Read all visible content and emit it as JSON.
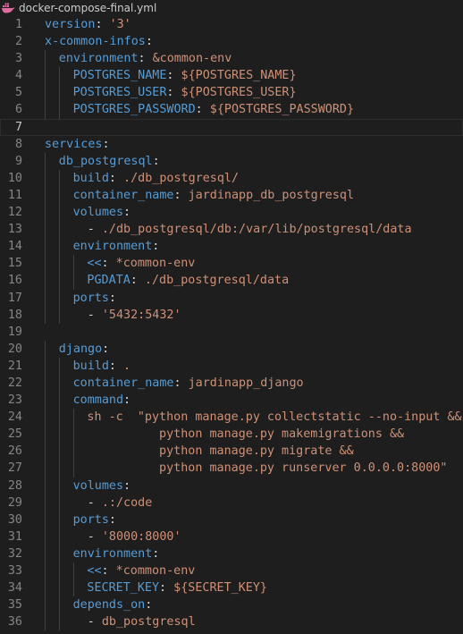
{
  "tab": {
    "filename": "docker-compose-final.yml",
    "icon": "docker-whale-icon"
  },
  "colors": {
    "background": "#1e1e1e",
    "key": "#569cd6",
    "string": "#ce9178",
    "punct": "#d4d4d4",
    "line_number": "#858585"
  },
  "current_line": 7,
  "lines": [
    {
      "n": "1",
      "indent": 0,
      "tokens": [
        [
          "k",
          "version"
        ],
        [
          "p",
          ": "
        ],
        [
          "s",
          "'3'"
        ]
      ]
    },
    {
      "n": "2",
      "indent": 0,
      "tokens": [
        [
          "k",
          "x-common-infos"
        ],
        [
          "p",
          ":"
        ]
      ]
    },
    {
      "n": "3",
      "indent": 1,
      "tokens": [
        [
          "k",
          "environment"
        ],
        [
          "p",
          ": "
        ],
        [
          "a",
          "&common-env"
        ]
      ]
    },
    {
      "n": "4",
      "indent": 2,
      "tokens": [
        [
          "k",
          "POSTGRES_NAME"
        ],
        [
          "p",
          ": "
        ],
        [
          "s",
          "${POSTGRES_NAME}"
        ]
      ]
    },
    {
      "n": "5",
      "indent": 2,
      "tokens": [
        [
          "k",
          "POSTGRES_USER"
        ],
        [
          "p",
          ": "
        ],
        [
          "s",
          "${POSTGRES_USER}"
        ]
      ]
    },
    {
      "n": "6",
      "indent": 2,
      "tokens": [
        [
          "k",
          "POSTGRES_PASSWORD"
        ],
        [
          "p",
          ": "
        ],
        [
          "s",
          "${POSTGRES_PASSWORD}"
        ]
      ]
    },
    {
      "n": "7",
      "indent": 0,
      "tokens": []
    },
    {
      "n": "8",
      "indent": 0,
      "tokens": [
        [
          "k",
          "services"
        ],
        [
          "p",
          ":"
        ]
      ]
    },
    {
      "n": "9",
      "indent": 1,
      "tokens": [
        [
          "k",
          "db_postgresql"
        ],
        [
          "p",
          ":"
        ]
      ]
    },
    {
      "n": "10",
      "indent": 2,
      "tokens": [
        [
          "k",
          "build"
        ],
        [
          "p",
          ": "
        ],
        [
          "s",
          "./db_postgresql/"
        ]
      ]
    },
    {
      "n": "11",
      "indent": 2,
      "tokens": [
        [
          "k",
          "container_name"
        ],
        [
          "p",
          ": "
        ],
        [
          "s",
          "jardinapp_db_postgresql"
        ]
      ]
    },
    {
      "n": "12",
      "indent": 2,
      "tokens": [
        [
          "k",
          "volumes"
        ],
        [
          "p",
          ":"
        ]
      ]
    },
    {
      "n": "13",
      "indent": 2,
      "tokens": [
        [
          "p",
          "  - "
        ],
        [
          "s",
          "./db_postgresql/db:/var/lib/postgresql/data"
        ]
      ]
    },
    {
      "n": "14",
      "indent": 2,
      "tokens": [
        [
          "k",
          "environment"
        ],
        [
          "p",
          ":"
        ]
      ]
    },
    {
      "n": "15",
      "indent": 3,
      "tokens": [
        [
          "k",
          "<<"
        ],
        [
          "p",
          ": "
        ],
        [
          "a",
          "*common-env"
        ]
      ]
    },
    {
      "n": "16",
      "indent": 3,
      "tokens": [
        [
          "k",
          "PGDATA"
        ],
        [
          "p",
          ": "
        ],
        [
          "s",
          "./db_postgresql/data"
        ]
      ]
    },
    {
      "n": "17",
      "indent": 2,
      "tokens": [
        [
          "k",
          "ports"
        ],
        [
          "p",
          ":"
        ]
      ]
    },
    {
      "n": "18",
      "indent": 2,
      "tokens": [
        [
          "p",
          "  - "
        ],
        [
          "s",
          "'5432:5432'"
        ]
      ]
    },
    {
      "n": "19",
      "indent": 0,
      "tokens": []
    },
    {
      "n": "20",
      "indent": 1,
      "tokens": [
        [
          "k",
          "django"
        ],
        [
          "p",
          ":"
        ]
      ]
    },
    {
      "n": "21",
      "indent": 2,
      "tokens": [
        [
          "k",
          "build"
        ],
        [
          "p",
          ": "
        ],
        [
          "s",
          "."
        ]
      ]
    },
    {
      "n": "22",
      "indent": 2,
      "tokens": [
        [
          "k",
          "container_name"
        ],
        [
          "p",
          ": "
        ],
        [
          "s",
          "jardinapp_django"
        ]
      ]
    },
    {
      "n": "23",
      "indent": 2,
      "tokens": [
        [
          "k",
          "command"
        ],
        [
          "p",
          ":"
        ]
      ]
    },
    {
      "n": "24",
      "indent": 3,
      "tokens": [
        [
          "s",
          "sh -c  \"python manage.py collectstatic --no-input &&"
        ]
      ]
    },
    {
      "n": "25",
      "indent": 3,
      "tokens": [
        [
          "s",
          "          python manage.py makemigrations &&"
        ]
      ]
    },
    {
      "n": "26",
      "indent": 3,
      "tokens": [
        [
          "s",
          "          python manage.py migrate &&"
        ]
      ]
    },
    {
      "n": "27",
      "indent": 3,
      "tokens": [
        [
          "s",
          "          python manage.py runserver 0.0.0.0:8000\""
        ]
      ]
    },
    {
      "n": "28",
      "indent": 2,
      "tokens": [
        [
          "k",
          "volumes"
        ],
        [
          "p",
          ":"
        ]
      ]
    },
    {
      "n": "29",
      "indent": 2,
      "tokens": [
        [
          "p",
          "  - "
        ],
        [
          "s",
          ".:/code"
        ]
      ]
    },
    {
      "n": "30",
      "indent": 2,
      "tokens": [
        [
          "k",
          "ports"
        ],
        [
          "p",
          ":"
        ]
      ]
    },
    {
      "n": "31",
      "indent": 2,
      "tokens": [
        [
          "p",
          "  - "
        ],
        [
          "s",
          "'8000:8000'"
        ]
      ]
    },
    {
      "n": "32",
      "indent": 2,
      "tokens": [
        [
          "k",
          "environment"
        ],
        [
          "p",
          ":"
        ]
      ]
    },
    {
      "n": "33",
      "indent": 3,
      "tokens": [
        [
          "k",
          "<<"
        ],
        [
          "p",
          ": "
        ],
        [
          "a",
          "*common-env"
        ]
      ]
    },
    {
      "n": "34",
      "indent": 3,
      "tokens": [
        [
          "k",
          "SECRET_KEY"
        ],
        [
          "p",
          ": "
        ],
        [
          "s",
          "${SECRET_KEY}"
        ]
      ]
    },
    {
      "n": "35",
      "indent": 2,
      "tokens": [
        [
          "k",
          "depends_on"
        ],
        [
          "p",
          ":"
        ]
      ]
    },
    {
      "n": "36",
      "indent": 2,
      "tokens": [
        [
          "p",
          "  - "
        ],
        [
          "s",
          "db_postgresql"
        ]
      ]
    }
  ]
}
